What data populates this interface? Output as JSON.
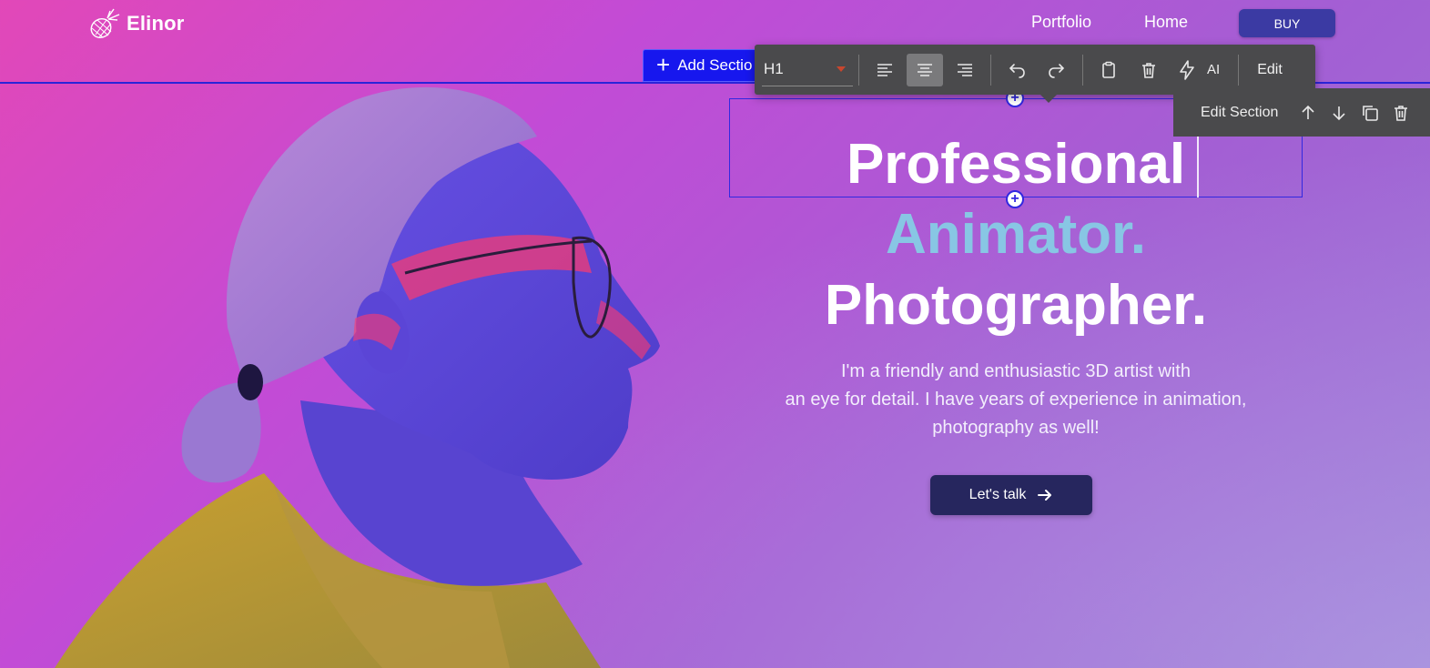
{
  "brand": {
    "name": "Elinor",
    "icon": "pineapple-icon"
  },
  "nav": {
    "portfolio": "Portfolio",
    "home": "Home",
    "buy": "BUY"
  },
  "editor": {
    "add_section": "Add Sectio",
    "tag": "H1",
    "ai_label": "AI",
    "edit_label": "Edit",
    "section_label": "Edit Section",
    "icons": [
      "align-left-icon",
      "align-center-icon",
      "align-right-icon",
      "undo-icon",
      "redo-icon",
      "clipboard-icon",
      "trash-icon",
      "lightning-icon",
      "arrow-up-icon",
      "arrow-down-icon",
      "duplicate-icon",
      "trash-icon"
    ]
  },
  "hero": {
    "line1": "Professional",
    "line2": "Animator.",
    "line3": "Photographer.",
    "description": [
      "I'm a friendly and enthusiastic 3D artist with",
      "an eye for detail. I have years of experience in animation,",
      "photography as well!"
    ],
    "cta": "Let's talk"
  },
  "colors": {
    "accent_text": "#88c6e4",
    "button_dark": "#26265e",
    "buy_button": "#3b3aa3",
    "selection": "#3228e0",
    "toolbar": "#4a4a4c"
  }
}
